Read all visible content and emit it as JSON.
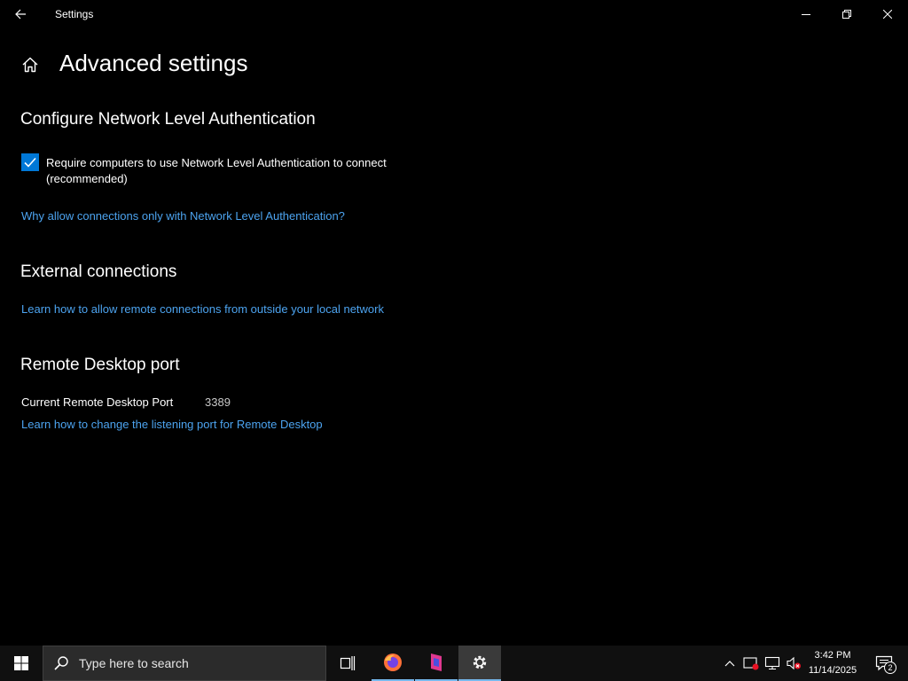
{
  "window": {
    "title": "Settings"
  },
  "page": {
    "title": "Advanced settings"
  },
  "nla": {
    "heading": "Configure Network Level Authentication",
    "checkbox_label": "Require computers to use Network Level Authentication to connect (recommended)",
    "checked": true,
    "link": "Why allow connections only with Network Level Authentication?"
  },
  "external": {
    "heading": "External connections",
    "link": "Learn how to allow remote connections from outside your local network"
  },
  "port": {
    "heading": "Remote Desktop port",
    "label": "Current Remote Desktop Port",
    "value": "3389",
    "link": "Learn how to change the listening port for Remote Desktop"
  },
  "taskbar": {
    "search_placeholder": "Type here to search",
    "time": "3:42 PM",
    "date": "11/14/2025",
    "notification_count": "2"
  },
  "colors": {
    "accent": "#0078d7",
    "link": "#4ca3ef",
    "background": "#000000",
    "taskbar": "#101010"
  },
  "icons": [
    "back-arrow-icon",
    "minimize-icon",
    "maximize-icon",
    "close-icon",
    "home-icon",
    "checkmark-icon",
    "windows-logo-icon",
    "search-icon",
    "task-view-icon",
    "firefox-icon",
    "app-icon",
    "gear-icon",
    "chevron-up-icon",
    "security-icon",
    "network-icon",
    "volume-muted-icon",
    "notification-icon"
  ]
}
